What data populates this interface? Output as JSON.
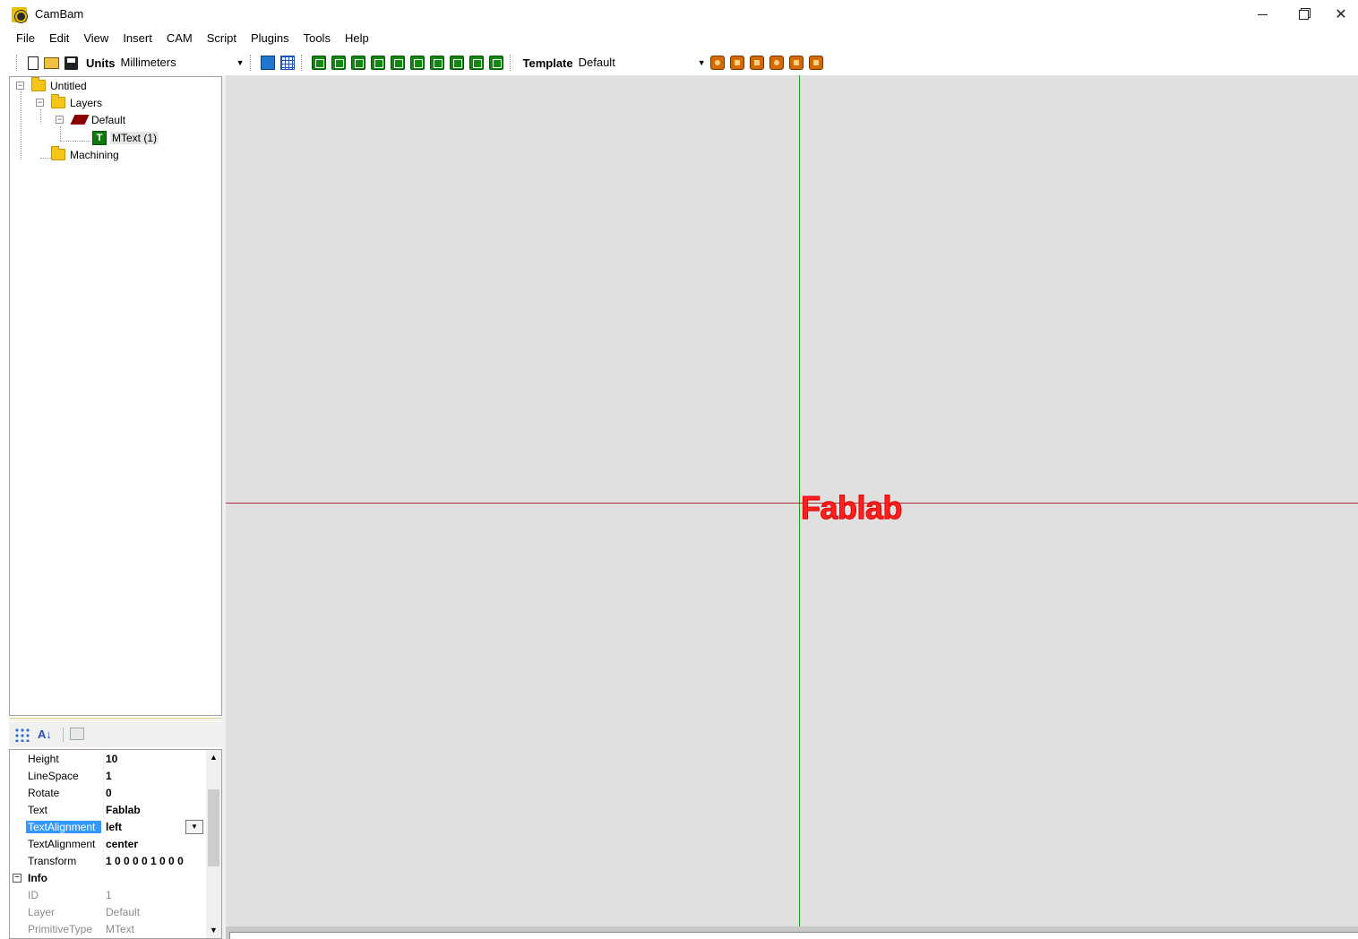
{
  "window": {
    "title": "CamBam"
  },
  "menu": [
    "File",
    "Edit",
    "View",
    "Insert",
    "CAM",
    "Script",
    "Plugins",
    "Tools",
    "Help"
  ],
  "toolbar": {
    "units_label": "Units",
    "units_value": "Millimeters",
    "template_label": "Template",
    "template_value": "Default",
    "draw_tool_letters": [
      "L",
      "C",
      "",
      "",
      "P",
      "R",
      "",
      "",
      "",
      "T"
    ]
  },
  "tree": {
    "root": "Untitled",
    "layers": "Layers",
    "layer_default": "Default",
    "mtext": "MText (1)",
    "machining": "Machining"
  },
  "properties": {
    "rows": [
      {
        "name": "Height",
        "value": "10"
      },
      {
        "name": "LineSpace",
        "value": "1"
      },
      {
        "name": "Rotate",
        "value": "0"
      },
      {
        "name": "Text",
        "value": "Fablab"
      },
      {
        "name": "TextAlignment",
        "value": "left"
      },
      {
        "name": "TextAlignment",
        "value": "center"
      },
      {
        "name": "Transform",
        "value": "1 0 0 0 0 1 0 0 0"
      }
    ],
    "info_category": "Info",
    "info_rows": [
      {
        "name": "ID",
        "value": "1"
      },
      {
        "name": "Layer",
        "value": "Default"
      },
      {
        "name": "PrimitiveType",
        "value": "MText"
      }
    ]
  },
  "canvas": {
    "text": "Fablab"
  },
  "colors": {
    "x_axis": "#a8302c",
    "y_axis": "#1ea11e",
    "canvas_bg": "#e0e0e0",
    "text_color": "#ff2020",
    "selection": "#3399ff"
  }
}
